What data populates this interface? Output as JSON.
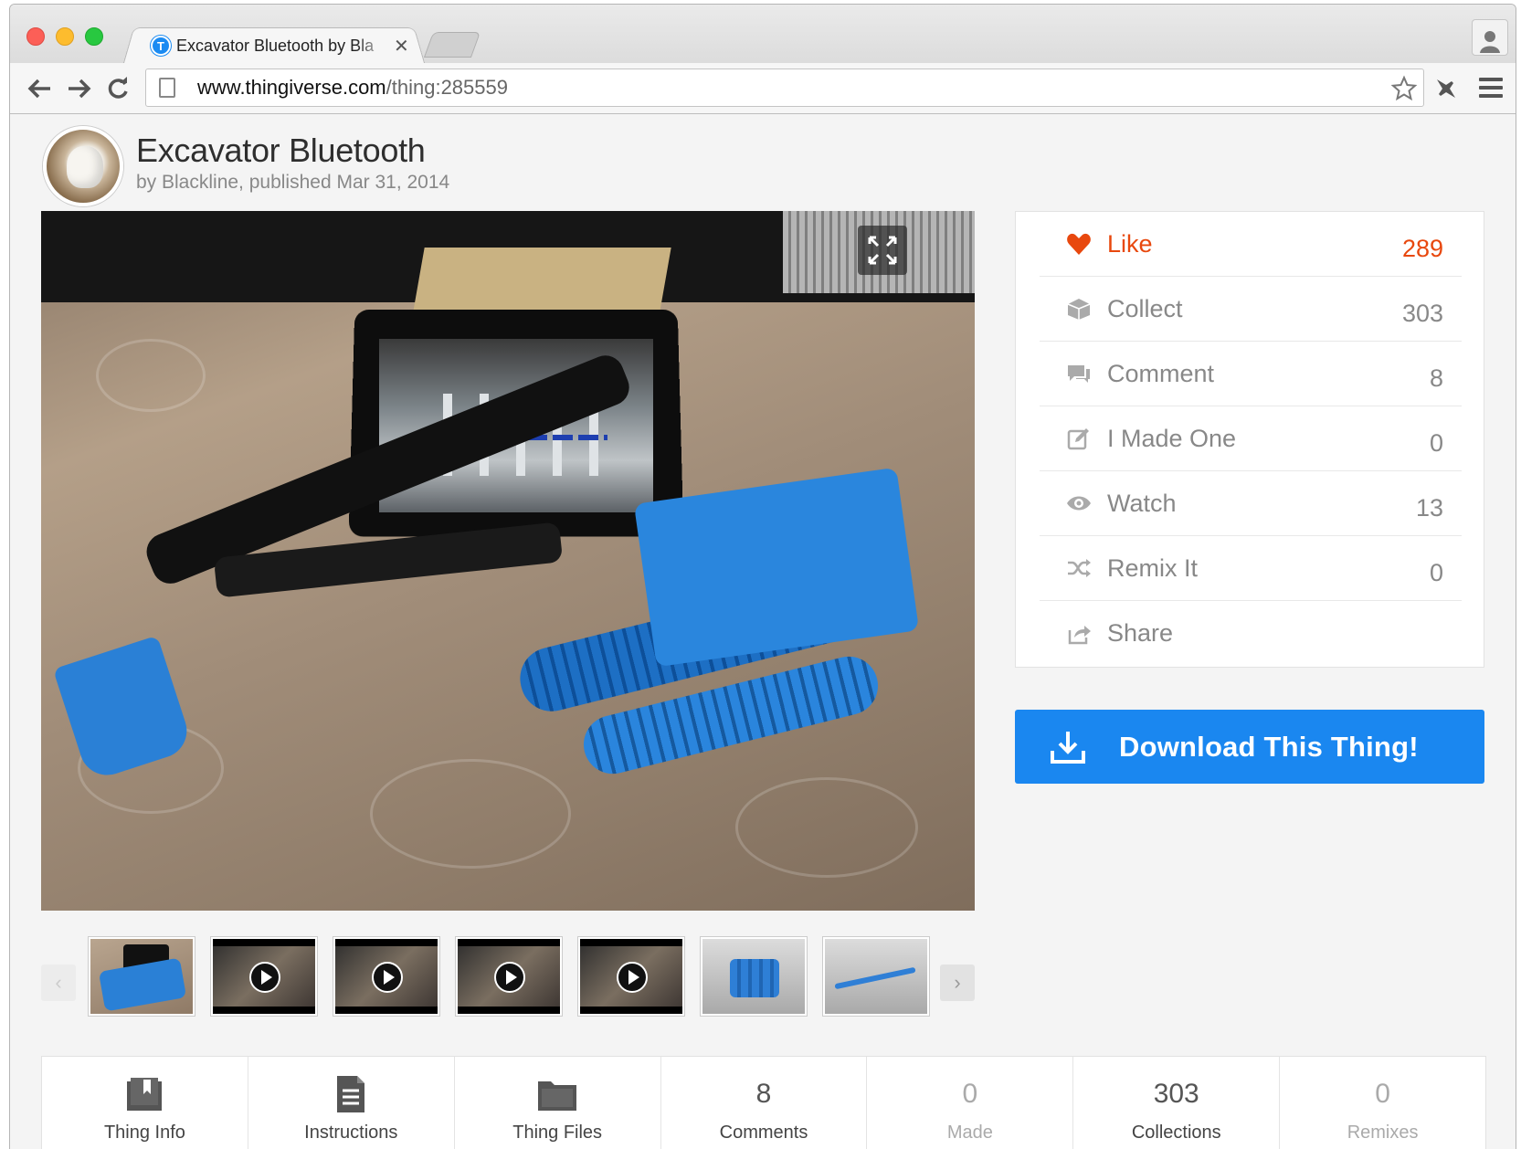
{
  "browser": {
    "tab_title": "Excavator Bluetooth by Bla",
    "url_host": "www.thingiverse.com",
    "url_path": "/thing:285559"
  },
  "thing": {
    "title": "Excavator Bluetooth",
    "meta": "by Blackline, published Mar 31, 2014"
  },
  "actions": [
    {
      "label": "Like",
      "count": "289",
      "icon": "heart-icon"
    },
    {
      "label": "Collect",
      "count": "303",
      "icon": "collect-icon"
    },
    {
      "label": "Comment",
      "count": "8",
      "icon": "comment-icon"
    },
    {
      "label": "I Made One",
      "count": "0",
      "icon": "edit-icon"
    },
    {
      "label": "Watch",
      "count": "13",
      "icon": "eye-icon"
    },
    {
      "label": "Remix It",
      "count": "0",
      "icon": "shuffle-icon"
    },
    {
      "label": "Share",
      "count": "",
      "icon": "share-icon"
    }
  ],
  "download": {
    "label": "Download This Thing!"
  },
  "thumbnails": [
    {
      "kind": "photo"
    },
    {
      "kind": "video"
    },
    {
      "kind": "video"
    },
    {
      "kind": "video"
    },
    {
      "kind": "video"
    },
    {
      "kind": "render-gear"
    },
    {
      "kind": "render-pen"
    }
  ],
  "bottom_tabs": [
    {
      "top": "",
      "label": "Thing Info",
      "icon": "book-icon"
    },
    {
      "top": "",
      "label": "Instructions",
      "icon": "document-icon"
    },
    {
      "top": "",
      "label": "Thing Files",
      "icon": "folder-icon"
    },
    {
      "top": "8",
      "label": "Comments"
    },
    {
      "top": "0",
      "label": "Made"
    },
    {
      "top": "303",
      "label": "Collections"
    },
    {
      "top": "0",
      "label": "Remixes"
    }
  ],
  "colors": {
    "like": "#e8480e",
    "download": "#1a87f0"
  }
}
